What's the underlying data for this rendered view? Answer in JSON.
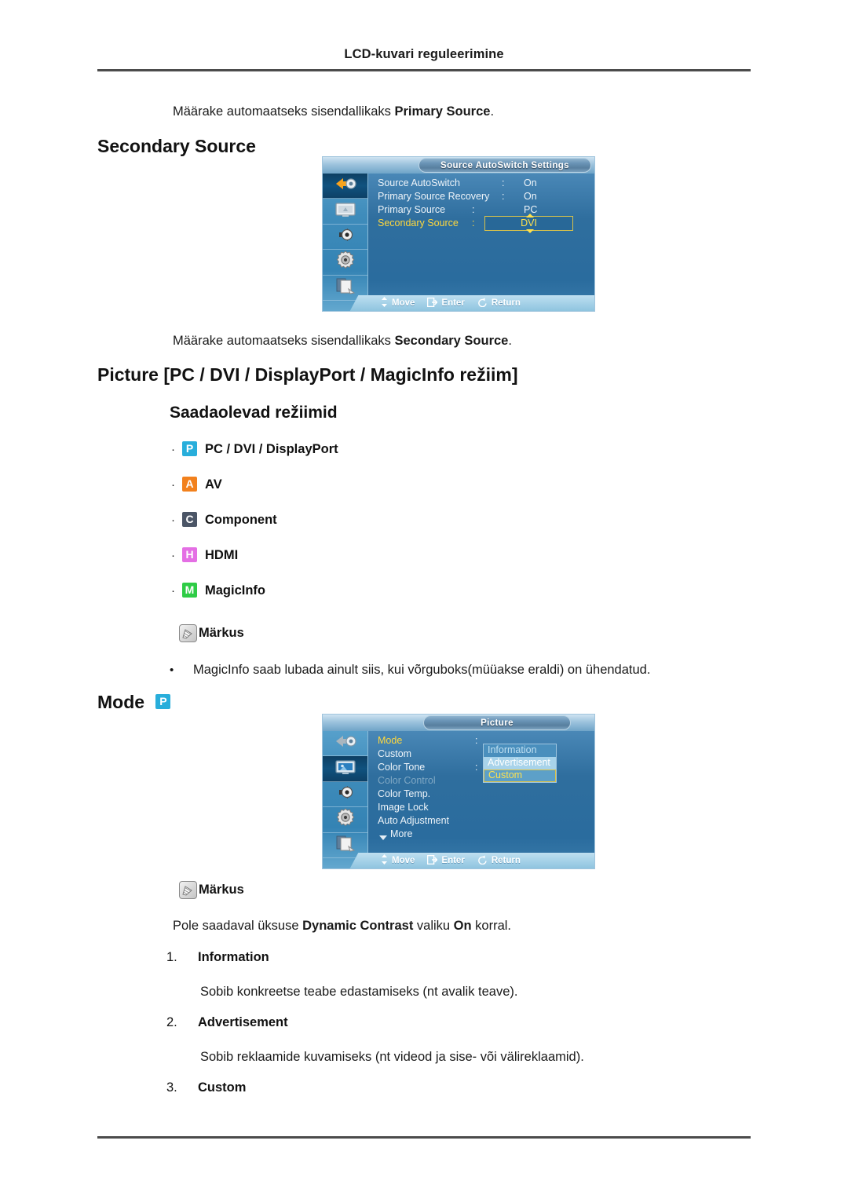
{
  "header": {
    "title": "LCD-kuvari reguleerimine"
  },
  "intro": {
    "line1_pre": "Määrake automaatseks sisendallikaks ",
    "line1_bold": "Primary Source",
    "line1_post": "."
  },
  "section_secondary": {
    "heading": "Secondary Source",
    "caption_pre": "Määrake automaatseks sisendallikaks ",
    "caption_bold": "Secondary Source",
    "caption_post": "."
  },
  "osd_source": {
    "title": "Source AutoSwitch Settings",
    "rail": [
      {
        "icon": "input-source-icon",
        "active": true
      },
      {
        "icon": "picture-icon",
        "active": false
      },
      {
        "icon": "sound-icon",
        "active": false
      },
      {
        "icon": "setup-gear-icon",
        "active": false
      },
      {
        "icon": "multi-control-icon",
        "active": false
      }
    ],
    "rows": [
      {
        "name": "Source AutoSwitch",
        "colon": ":",
        "value": "On",
        "selected": false
      },
      {
        "name": "Primary Source Recovery",
        "colon": ":",
        "value": "On",
        "selected": false
      },
      {
        "name": "Primary Source",
        "colon": ":",
        "value": "PC",
        "selected": false
      },
      {
        "name": "Secondary Source",
        "colon": ":",
        "value": "DVI",
        "selected": true
      }
    ],
    "nav": [
      {
        "icon": "move-updown-icon",
        "label": "Move"
      },
      {
        "icon": "enter-icon",
        "label": "Enter"
      },
      {
        "icon": "return-icon",
        "label": "Return"
      }
    ]
  },
  "section_picture": {
    "heading": "Picture [PC / DVI / DisplayPort / MagicInfo režiim]",
    "subheading": "Saadaolevad režiimid",
    "modes": [
      {
        "badge": "P",
        "badge_color": "#28aedb",
        "label": "PC / DVI / DisplayPort",
        "icon": "pc-source-badge-icon"
      },
      {
        "badge": "A",
        "badge_color": "#f2811d",
        "label": "AV",
        "icon": "av-source-badge-icon"
      },
      {
        "badge": "C",
        "badge_color": "#4b5566",
        "label": "Component",
        "icon": "component-source-badge-icon"
      },
      {
        "badge": "H",
        "badge_color": "#e46fe4",
        "label": "HDMI",
        "icon": "hdmi-source-badge-icon"
      },
      {
        "badge": "M",
        "badge_color": "#2ecc46",
        "label": "MagicInfo",
        "icon": "magicinfo-source-badge-icon"
      }
    ],
    "note1": {
      "label": "Märkus",
      "bullet": "MagicInfo saab lubada ainult siis, kui võrguboks(müüakse eraldi) on ühendatud."
    }
  },
  "section_mode": {
    "heading": "Mode",
    "badge": "P",
    "badge_color": "#28aedb",
    "note2": {
      "label": "Märkus"
    },
    "note2_text_pre": "Pole saadaval üksuse ",
    "note2_text_bold1": "Dynamic Contrast",
    "note2_text_mid": " valiku ",
    "note2_text_bold2": "On",
    "note2_text_post": " korral.",
    "items": [
      {
        "index": "1.",
        "label": "Information",
        "desc": "Sobib konkreetse teabe edastamiseks (nt avalik teave)."
      },
      {
        "index": "2.",
        "label": "Advertisement",
        "desc": "Sobib reklaamide kuvamiseks (nt videod ja sise- või välireklaamid)."
      },
      {
        "index": "3.",
        "label": "Custom",
        "desc": ""
      }
    ]
  },
  "osd_picture": {
    "title": "Picture",
    "rail": [
      {
        "icon": "input-source-icon",
        "active": false
      },
      {
        "icon": "picture-icon",
        "active": true
      },
      {
        "icon": "sound-icon",
        "active": false
      },
      {
        "icon": "setup-gear-icon",
        "active": false
      },
      {
        "icon": "multi-control-icon",
        "active": false
      }
    ],
    "rows": [
      {
        "name": "Mode",
        "colon": ":",
        "selected": true,
        "dim": false
      },
      {
        "name": "Custom",
        "colon": "",
        "selected": false,
        "dim": false
      },
      {
        "name": "Color Tone",
        "colon": ":",
        "selected": false,
        "dim": false
      },
      {
        "name": "Color Control",
        "colon": "",
        "selected": false,
        "dim": true
      },
      {
        "name": "Color Temp.",
        "colon": "",
        "selected": false,
        "dim": false
      },
      {
        "name": "Image Lock",
        "colon": "",
        "selected": false,
        "dim": false
      },
      {
        "name": "Auto Adjustment",
        "colon": "",
        "selected": false,
        "dim": false
      },
      {
        "name": "More",
        "colon": "",
        "selected": false,
        "dim": false,
        "more": true
      }
    ],
    "dropdown": [
      {
        "label": "Information",
        "state": "a"
      },
      {
        "label": "Advertisement",
        "state": "b"
      },
      {
        "label": "Custom",
        "state": "c"
      }
    ],
    "nav": [
      {
        "icon": "move-updown-icon",
        "label": "Move"
      },
      {
        "icon": "enter-icon",
        "label": "Enter"
      },
      {
        "icon": "return-icon",
        "label": "Return"
      }
    ]
  }
}
